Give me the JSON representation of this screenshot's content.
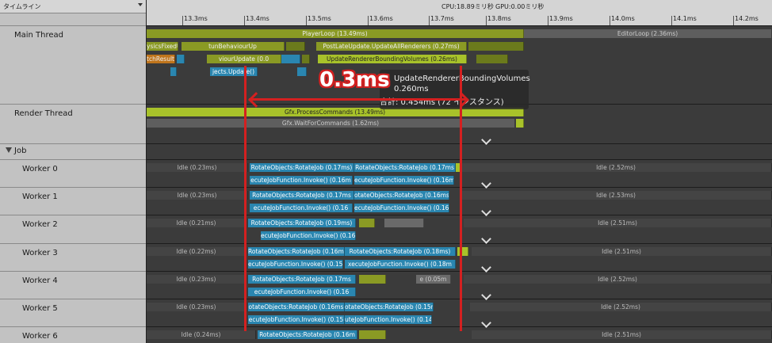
{
  "timeline_selector": {
    "label": "タイムライン"
  },
  "header": {
    "cpu": "CPU:18.89ミリ秒",
    "gpu": "GPU:0.00ミリ秒"
  },
  "ruler": {
    "ticks": [
      "13.3ms",
      "13.4ms",
      "13.5ms",
      "13.6ms",
      "13.7ms",
      "13.8ms",
      "13.9ms",
      "14.0ms",
      "14.1ms",
      "14.2ms"
    ]
  },
  "threads": {
    "main": "Main Thread",
    "render": "Render Thread",
    "job": "Job",
    "workers": [
      "Worker 0",
      "Worker 1",
      "Worker 2",
      "Worker 3",
      "Worker 4",
      "Worker 5",
      "Worker 6"
    ]
  },
  "main_bars": {
    "player_loop": "PlayerLoop (13.49ms)",
    "editor_loop": "EditorLoop (2.36ms)",
    "physics_fixed": "ysicsFixedU",
    "run_behaviour": "tunBehaviourUp",
    "post_late": "PostLateUpdate.UpdateAllRenderers (0.27ms)",
    "fetch_result": "tchResult",
    "behaviour_update": "viourUpdate (0.0",
    "update_bounding": "UpdateRendererBoundingVolumes (0.26ms)",
    "objects_update": "jects.Update()"
  },
  "render_bars": {
    "process": "Gfx.ProcessCommands (13.49ms)",
    "wait": "Gfx.WaitForCommands (1.62ms)"
  },
  "tooltip": {
    "name": "UpdateRendererBoundingVolumes",
    "time": "0.260ms",
    "total": "合計: 0.454ms (72 インスタンス)"
  },
  "workers_bars": [
    {
      "idle1": "Idle (0.23ms)",
      "rot1": "RotateObjects:RotateJob (0.17ms)",
      "rot2": "RotateObjects:RotateJob (0.17ms",
      "exe1": "ecuteJobFunction.Invoke() (0.16m",
      "exe2": "ecuteJobFunction.Invoke() (0.16m",
      "idle2": "Idle (2.52ms)"
    },
    {
      "idle1": "Idle (0.23ms)",
      "rot1": "RotateObjects:RotateJob (0.17ms",
      "rot2": "otateObjects:RotateJob (0.16ms)",
      "exe1": "ecuteJobFunction.Invoke() (0.16",
      "exe2": "ecuteJobFunction.Invoke() (0.16m",
      "idle2": "Idle (2.53ms)"
    },
    {
      "idle1": "Idle (0.21ms)",
      "rot1": "RotateObjects:RotateJob (0.19ms)",
      "exe1": "ecuteJobFunction.Invoke() (0.16",
      "idle2": "Idle (2.51ms)"
    },
    {
      "idle1": "Idle (0.22ms)",
      "rot1": "RotateObjects:RotateJob (0.16ms",
      "rot2": "RotateObjects:RotateJob (0.18ms)",
      "exe1": "ecuteJobFunction.Invoke() (0.15",
      "exe2": "xecuteJobFunction.Invoke() (0.18m",
      "idle2": "Idle (2.51ms)"
    },
    {
      "idle1": "Idle (0.23ms)",
      "rot1": "RotateObjects:RotateJob (0.17ms",
      "small": "e (0.05m",
      "exe1": "ecuteJobFunction.Invoke() (0.16",
      "idle2": "Idle (2.52ms)"
    },
    {
      "idle1": "Idle (0.23ms)",
      "rot1": "otateObjects:RotateJob (0.16ms",
      "rot2": "otateObjects:RotateJob (0.15n",
      "exe1": "ecuteJobFunction.Invoke() (0.15",
      "exe2": "uteJobFunction.Invoke() (0.14m",
      "idle2": "Idle (2.52ms)"
    },
    {
      "idle1": "Idle (0.24ms)",
      "rot1": "RotateObjects:RotateJob (0.16m",
      "idle2": "Idle (2.51ms)"
    }
  ],
  "annotation": {
    "label": "0.3ms"
  }
}
